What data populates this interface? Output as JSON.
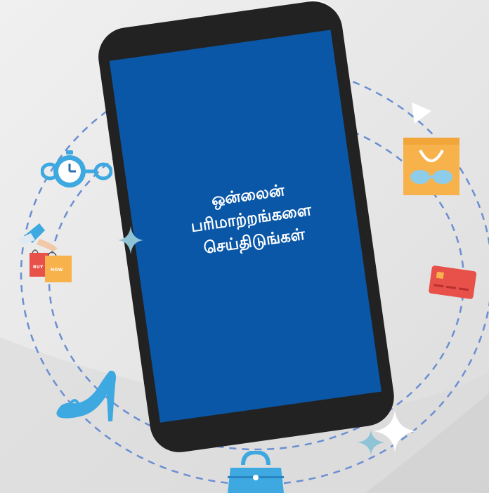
{
  "screen": {
    "message_lines": [
      "ஒன்லைன்",
      "பரிமாற்றங்களை",
      "செய்திடுங்கள்"
    ]
  },
  "bags": {
    "buy_label": "BUY",
    "now_label": "NOW"
  },
  "colors": {
    "screen": "#0a57a8",
    "phone_body": "#222222",
    "accent_light_blue": "#3ea8e0",
    "dashed_orbit": "#6b8fd1",
    "bag_orange": "#f7b24c",
    "card_red": "#e8504a",
    "background": "#ebebeb"
  },
  "icons": [
    "watch-icon",
    "shopping-hand-icon",
    "high-heel-shoe-icon",
    "handbag-icon",
    "sparkle-icon",
    "shopping-bag-icon",
    "play-triangle-icon",
    "credit-card-icon"
  ]
}
